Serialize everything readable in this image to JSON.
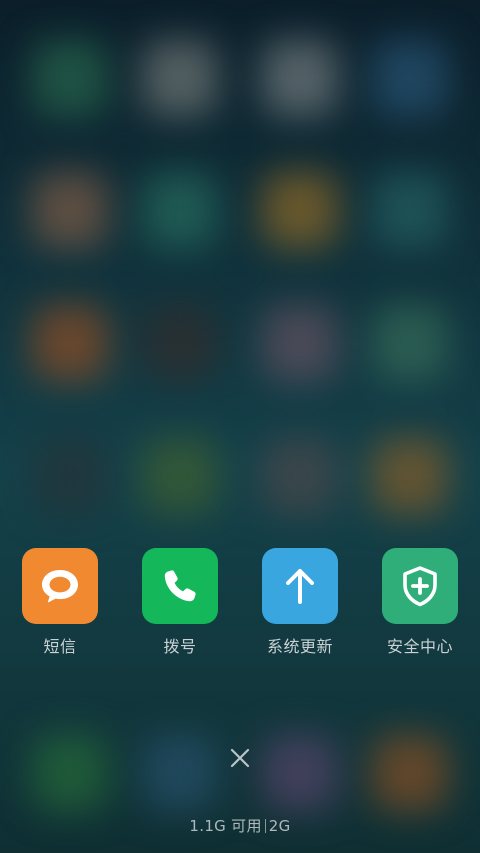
{
  "dock": {
    "apps": [
      {
        "label": "短信",
        "icon": "message-bubble-icon",
        "color": "#f0892f"
      },
      {
        "label": "拨号",
        "icon": "phone-icon",
        "color": "#14b85b"
      },
      {
        "label": "系统更新",
        "icon": "arrow-up-icon",
        "color": "#3aa6e0"
      },
      {
        "label": "安全中心",
        "icon": "shield-plus-icon",
        "color": "#2fae7a"
      }
    ]
  },
  "footer": {
    "memory_available": "1.1G 可用",
    "memory_total": "2G"
  }
}
